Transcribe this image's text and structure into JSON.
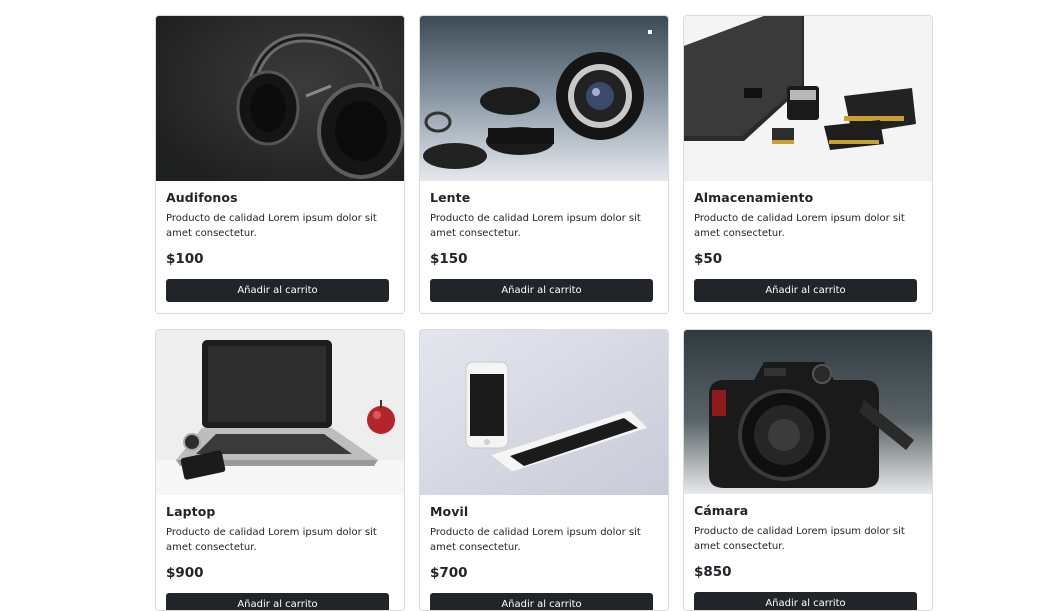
{
  "products": [
    {
      "name": "Audifonos",
      "description": "Producto de calidad Lorem ipsum dolor sit amet consectetur.",
      "price": "$100",
      "button": "Añadir al carrito",
      "image_icon": "headphones-image"
    },
    {
      "name": "Lente",
      "description": "Producto de calidad Lorem ipsum dolor sit amet consectetur.",
      "price": "$150",
      "button": "Añadir al carrito",
      "image_icon": "camera-lens-image"
    },
    {
      "name": "Almacenamiento",
      "description": "Producto de calidad Lorem ipsum dolor sit amet consectetur.",
      "price": "$50",
      "button": "Añadir al carrito",
      "image_icon": "storage-devices-image"
    },
    {
      "name": "Laptop",
      "description": "Producto de calidad Lorem ipsum dolor sit amet consectetur.",
      "price": "$900",
      "button": "Añadir al carrito",
      "image_icon": "laptop-image"
    },
    {
      "name": "Movil",
      "description": "Producto de calidad Lorem ipsum dolor sit amet consectetur.",
      "price": "$700",
      "button": "Añadir al carrito",
      "image_icon": "smartphones-image"
    },
    {
      "name": "Cámara",
      "description": "Producto de calidad Lorem ipsum dolor sit amet consectetur.",
      "price": "$850",
      "button": "Añadir al carrito",
      "image_icon": "camera-image"
    }
  ],
  "colors": {
    "button_bg": "#212529",
    "button_text": "#ffffff",
    "card_border": "#dcdcdc"
  }
}
